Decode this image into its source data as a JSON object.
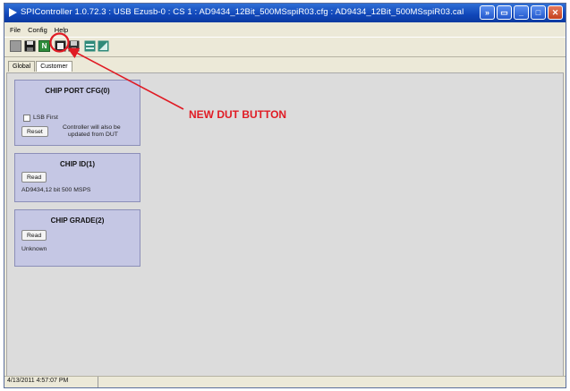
{
  "window": {
    "title": "SPIController 1.0.72.3 : USB Ezusb-0 : CS 1 : AD9434_12Bit_500MSspiR03.cfg : AD9434_12Bit_500MSspiR03.cal"
  },
  "menu": [
    "File",
    "Config",
    "Help"
  ],
  "toolbar": {
    "icons": [
      "blank-icon",
      "save-icon",
      "new-dut-icon",
      "device-icon",
      "floppy-icon",
      "chip-icon",
      "grid-icon"
    ],
    "new_dut_letter": "N"
  },
  "tabs": [
    {
      "label": "Global",
      "active": false
    },
    {
      "label": "Customer",
      "active": true
    }
  ],
  "panels": {
    "chip_port_cfg": {
      "title": "CHIP PORT CFG(0)",
      "lsb_first_label": "LSB First",
      "lsb_first_checked": false,
      "reset_label": "Reset",
      "note_line1": "Controller will also be",
      "note_line2": "updated from DUT"
    },
    "chip_id": {
      "title": "CHIP ID(1)",
      "read_label": "Read",
      "value": "AD9434,12 bit 500 MSPS"
    },
    "chip_grade": {
      "title": "CHIP GRADE(2)",
      "read_label": "Read",
      "value": "Unknown"
    }
  },
  "status": {
    "timestamp": "4/13/2011 4:57:07 PM"
  },
  "annotation": {
    "text": "NEW DUT BUTTON",
    "color": "#e01b24"
  },
  "colors": {
    "titlebar": "#1046b8",
    "panel": "#c5c7e4",
    "workspace": "#dcdcdc"
  }
}
